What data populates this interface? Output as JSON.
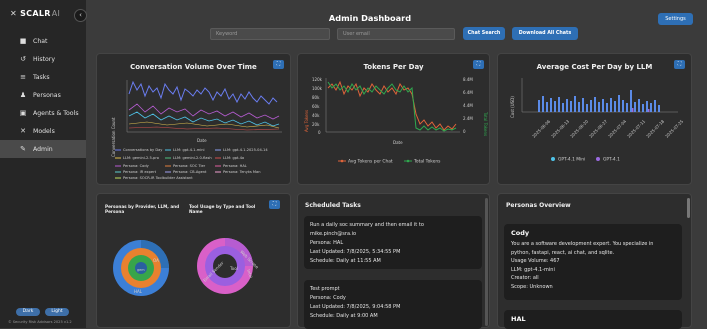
{
  "app": {
    "brand": "SCALR",
    "brand_suffix": "AI",
    "collapse_icon": "‹"
  },
  "sidebar": {
    "items": [
      {
        "label": "Chat",
        "icon": "■"
      },
      {
        "label": "History",
        "icon": "↺"
      },
      {
        "label": "Tasks",
        "icon": "≡"
      },
      {
        "label": "Personas",
        "icon": "♟"
      },
      {
        "label": "Agents & Tools",
        "icon": "▣"
      },
      {
        "label": "Models",
        "icon": "✕"
      },
      {
        "label": "Admin",
        "icon": "✎"
      }
    ],
    "theme_dark": "Dark",
    "theme_light": "Light",
    "footer": "© Security Risk Advisors 2025 v1.2"
  },
  "header": {
    "title": "Admin Dashboard",
    "settings": "Settings",
    "keyword_placeholder": "Keyword",
    "email_placeholder": "User email",
    "chat_search": "Chat Search",
    "download": "Download All Chats"
  },
  "charts": {
    "conversation": {
      "title": "Conversation Volume Over Time",
      "xlabel": "Date",
      "ylabel": "Conversation Count",
      "legend": [
        "Conversations by Day",
        "LLM: gpt-4.1-mini",
        "LLM: gpt-4.1-2025-04-14",
        "LLM: gemini-2.5-pro",
        "LLM: gemini-2.0-flash",
        "LLM: gpt-4o",
        "Persona: Cody",
        "Persona: SOC Tier",
        "Persona: HAL",
        "Persona: IR expert",
        "Persona: CB-Agent",
        "Persona: Tenyks Man",
        "Persona: SOCR-IR Toolbuilder Assistant"
      ]
    },
    "tokens": {
      "title": "Tokens Per Day",
      "xlabel": "Date",
      "ylabel_left": "Avg Tokens",
      "ylabel_right": "Total Tokens",
      "legend_avg": "Avg Tokens per Chat",
      "legend_total": "Total Tokens",
      "left_ticks": [
        "120k",
        "100k",
        "80k",
        "60k",
        "40k",
        "20k",
        "0"
      ],
      "right_ticks": [
        "8.4M",
        "6.4M",
        "4.4M",
        "2.4M",
        "0"
      ]
    },
    "cost": {
      "title": "Average Cost Per Day by LLM",
      "ylabel": "Cost (USD)",
      "dates": [
        "2025-06-06",
        "2025-06-13",
        "2025-06-20",
        "2025-06-27",
        "2025-07-04",
        "2025-07-11",
        "2025-07-18",
        "2025-07-25"
      ],
      "legend": [
        "GPT-4.1 Mini",
        "GPT-4.1"
      ]
    },
    "personas_sunburst": {
      "title": "Personas by Provider, LLM, and Persona",
      "labels": [
        "OA",
        "HAL",
        "gem"
      ]
    },
    "tools_sunburst": {
      "title": "Tool Usage by Type and Tool Name",
      "labels": [
        "Web Scrape",
        "Tool",
        "Email Sender",
        "Intel"
      ]
    }
  },
  "tasks": {
    "title": "Scheduled Tasks",
    "items": [
      {
        "description": "Run a daily soc summary and then email it to",
        "email": "mike.pinch@sra.io",
        "persona": "Persona: HAL",
        "updated": "Last Updated: 7/8/2025, 5:34:55 PM",
        "schedule": "Schedule: Daily at 11:55 AM"
      },
      {
        "description": "Test prompt",
        "persona": "Persona: Cody",
        "updated": "Last Updated: 7/8/2025, 9:04:58 PM",
        "schedule": "Schedule: Daily at 9:00 AM"
      }
    ]
  },
  "personas": {
    "title": "Personas Overview",
    "items": [
      {
        "name": "Cody",
        "desc1": "You are a software development expert. You specialize in",
        "desc2": "python, fastapi, react, ai chat, and sqlite.",
        "usage": "Usage Volume: 467",
        "llm": "LLM: gpt-4.1-mini",
        "creator": "Creator: all",
        "scope": "Scope: Unknown"
      },
      {
        "name": "HAL"
      }
    ]
  },
  "colors": {
    "accent": "#2e6fb5",
    "avg_tokens": "#e0643a",
    "total_tokens": "#2fa84f",
    "cost_bar": "#5b8be8"
  }
}
